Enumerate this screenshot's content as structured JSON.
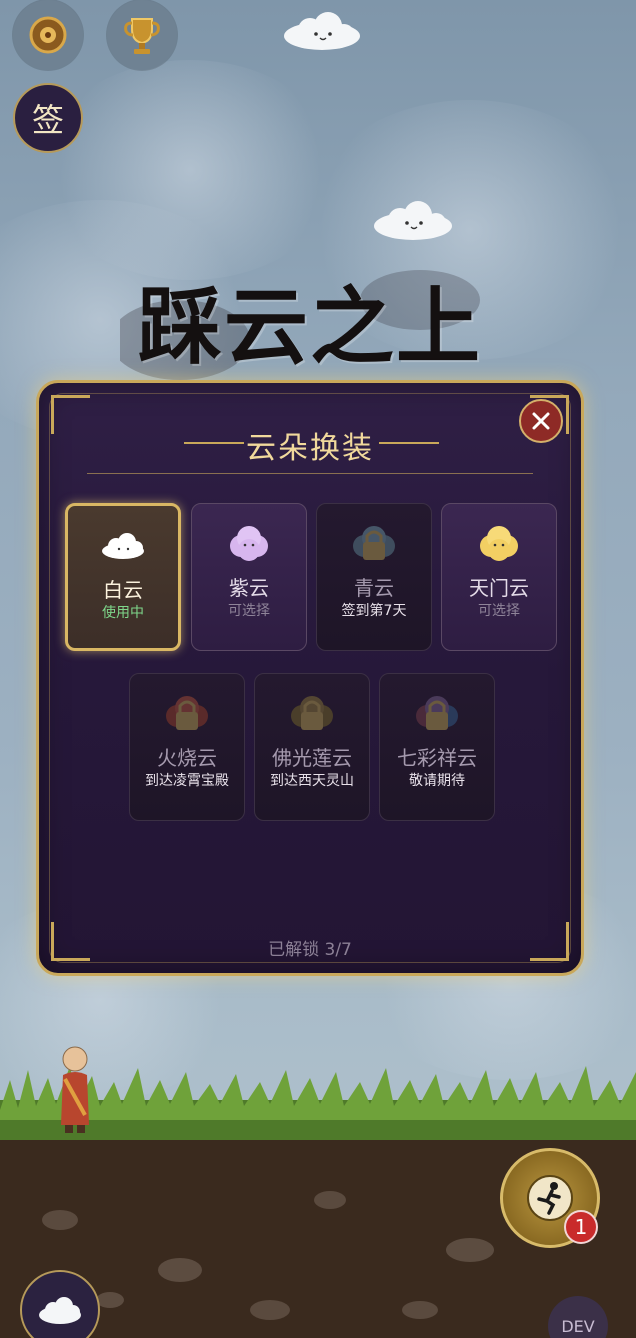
{
  "top_buttons": {
    "sign_label": "签"
  },
  "game_title": "踩云之上",
  "modal": {
    "title": "云朵换装",
    "cards": [
      {
        "name": "白云",
        "status": "使用中",
        "state": "active",
        "cloud_color": "#ffffff"
      },
      {
        "name": "紫云",
        "status": "可选择",
        "state": "available",
        "cloud_color": "#d7b6ee"
      },
      {
        "name": "青云",
        "status": "签到第7天",
        "state": "locked",
        "cloud_color": "#3f4d5e"
      },
      {
        "name": "天门云",
        "status": "可选择",
        "state": "available",
        "cloud_color": "#f2cf63"
      },
      {
        "name": "火烧云",
        "status": "到达凌霄宝殿",
        "state": "locked",
        "cloud_color": "#5a2a2a"
      },
      {
        "name": "佛光莲云",
        "status": "到达西天灵山",
        "state": "locked",
        "cloud_color": "#5a4a2a"
      },
      {
        "name": "七彩祥云",
        "status": "敬请期待",
        "state": "locked",
        "cloud_color": "#4a3a5a"
      }
    ],
    "unlocked_text": "已解锁 3/7"
  },
  "badge_count": "1",
  "dev_label": "DEV",
  "colors": {
    "gold": "#c9a85a",
    "panel": "#2a1b3d",
    "active_status": "#7ed68a"
  }
}
